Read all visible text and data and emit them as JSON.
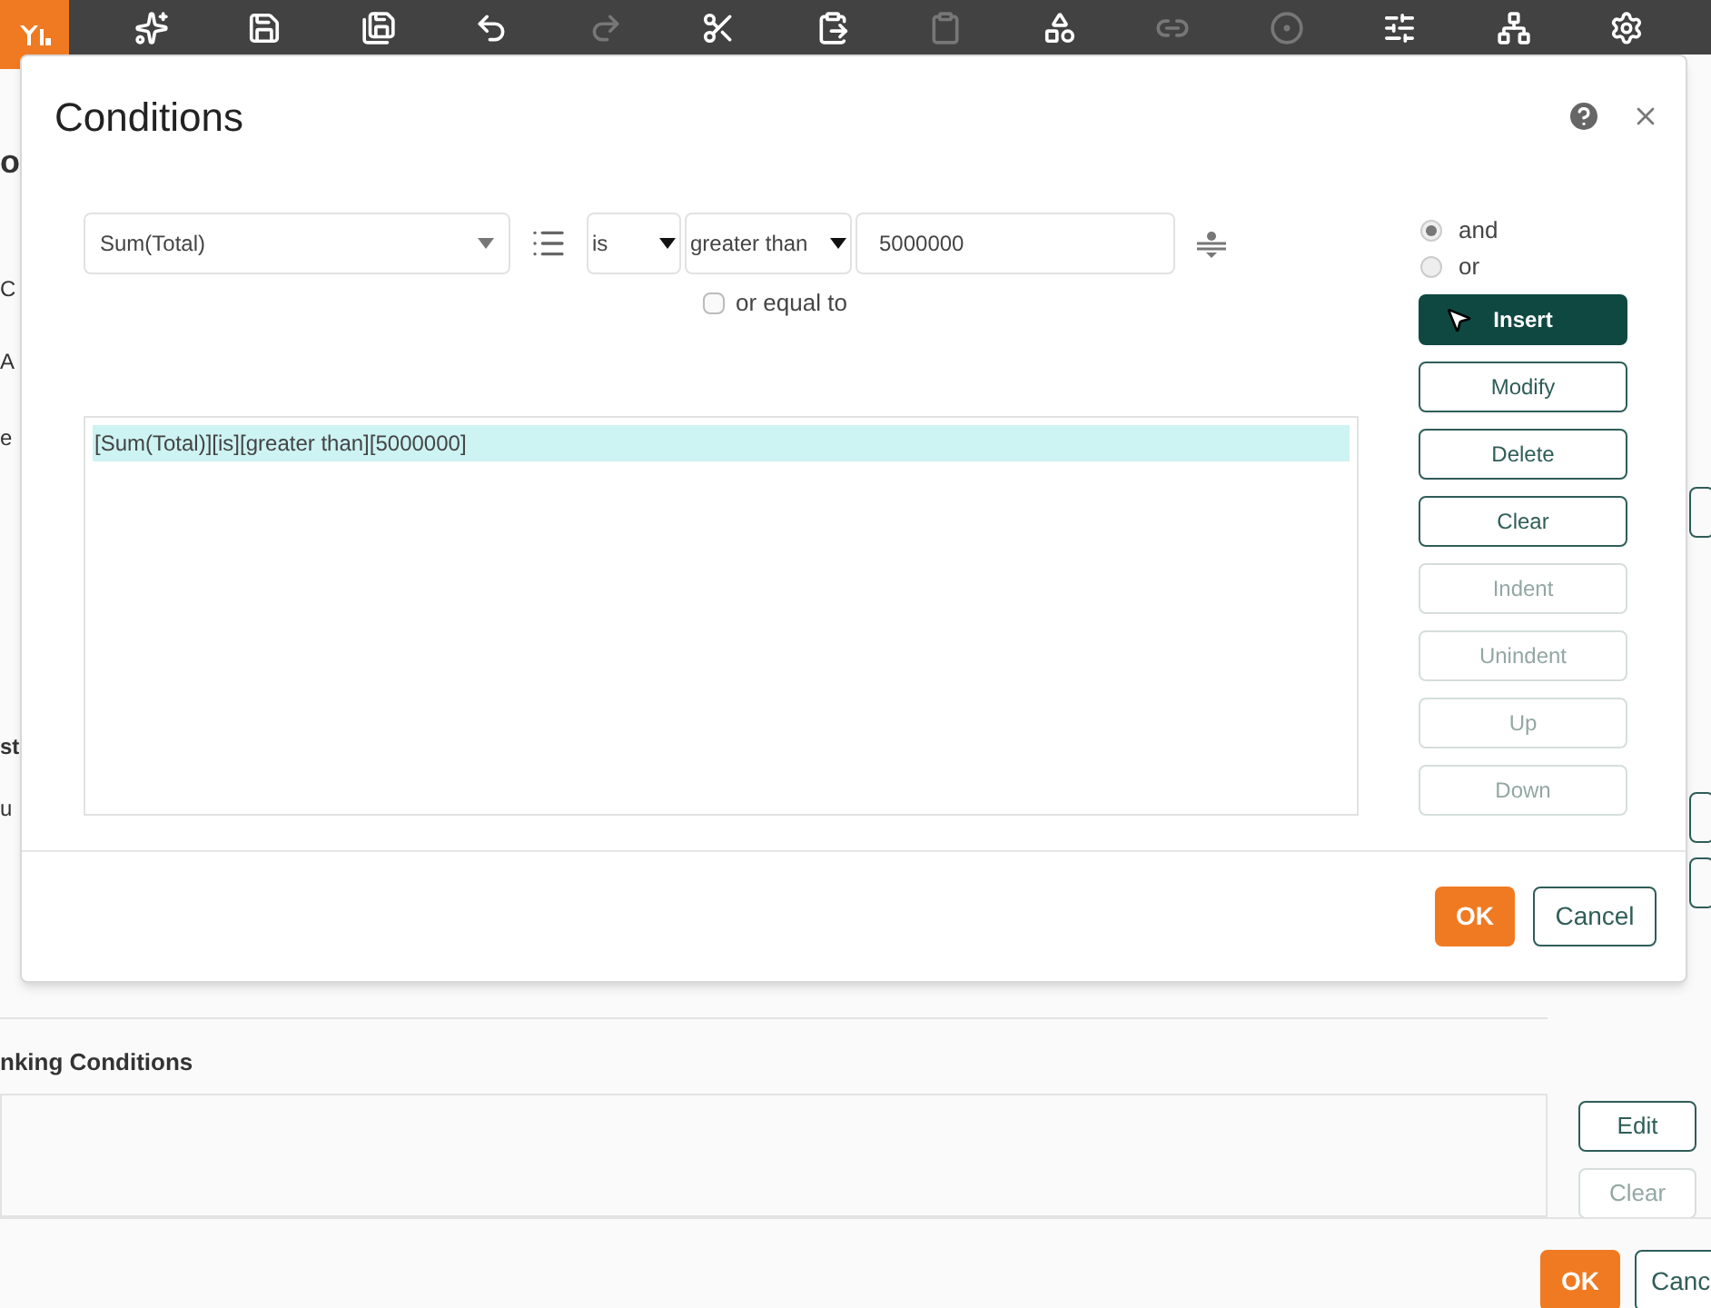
{
  "toolbar": [
    {
      "disabled": false
    },
    {
      "disabled": false
    },
    {
      "disabled": false
    },
    {
      "disabled": false
    },
    {
      "disabled": true
    },
    {
      "disabled": false
    },
    {
      "disabled": false
    },
    {
      "disabled": true
    },
    {
      "disabled": false
    },
    {
      "disabled": true
    },
    {
      "disabled": true
    },
    {
      "disabled": false
    },
    {
      "disabled": false
    },
    {
      "disabled": false
    }
  ],
  "background": {
    "fragments": [
      "o",
      "C",
      "A",
      "e",
      "st",
      "u"
    ],
    "section_title": "nking Conditions",
    "side_buttons": [
      {
        "label": "Edit",
        "disabled": false
      },
      {
        "label": "Clear",
        "disabled": true
      }
    ],
    "footer_buttons": [
      {
        "label": "OK",
        "kind": "primary"
      },
      {
        "label": "Canc",
        "kind": "secondary"
      }
    ]
  },
  "dialog": {
    "title": "Conditions",
    "field": {
      "value": "Sum(Total)"
    },
    "operator": {
      "value": "is"
    },
    "comparison": {
      "value": "greater than"
    },
    "amount": {
      "value": "5000000"
    },
    "or_equal": {
      "label": "or equal to",
      "checked": false
    },
    "logic": [
      {
        "label": "and",
        "selected": true
      },
      {
        "label": "or",
        "selected": false
      }
    ],
    "conditions": [
      {
        "text": "[Sum(Total)][is][greater than][5000000]",
        "selected": true
      }
    ],
    "actions": [
      {
        "label": "Insert",
        "kind": "primary",
        "disabled": false
      },
      {
        "label": "Modify",
        "kind": "secondary",
        "disabled": false
      },
      {
        "label": "Delete",
        "kind": "secondary",
        "disabled": false
      },
      {
        "label": "Clear",
        "kind": "secondary",
        "disabled": false
      },
      {
        "label": "Indent",
        "kind": "secondary",
        "disabled": true
      },
      {
        "label": "Unindent",
        "kind": "secondary",
        "disabled": true
      },
      {
        "label": "Up",
        "kind": "secondary",
        "disabled": true
      },
      {
        "label": "Down",
        "kind": "secondary",
        "disabled": true
      }
    ],
    "footer": [
      {
        "label": "OK",
        "kind": "primary"
      },
      {
        "label": "Cancel",
        "kind": "secondary"
      }
    ]
  }
}
